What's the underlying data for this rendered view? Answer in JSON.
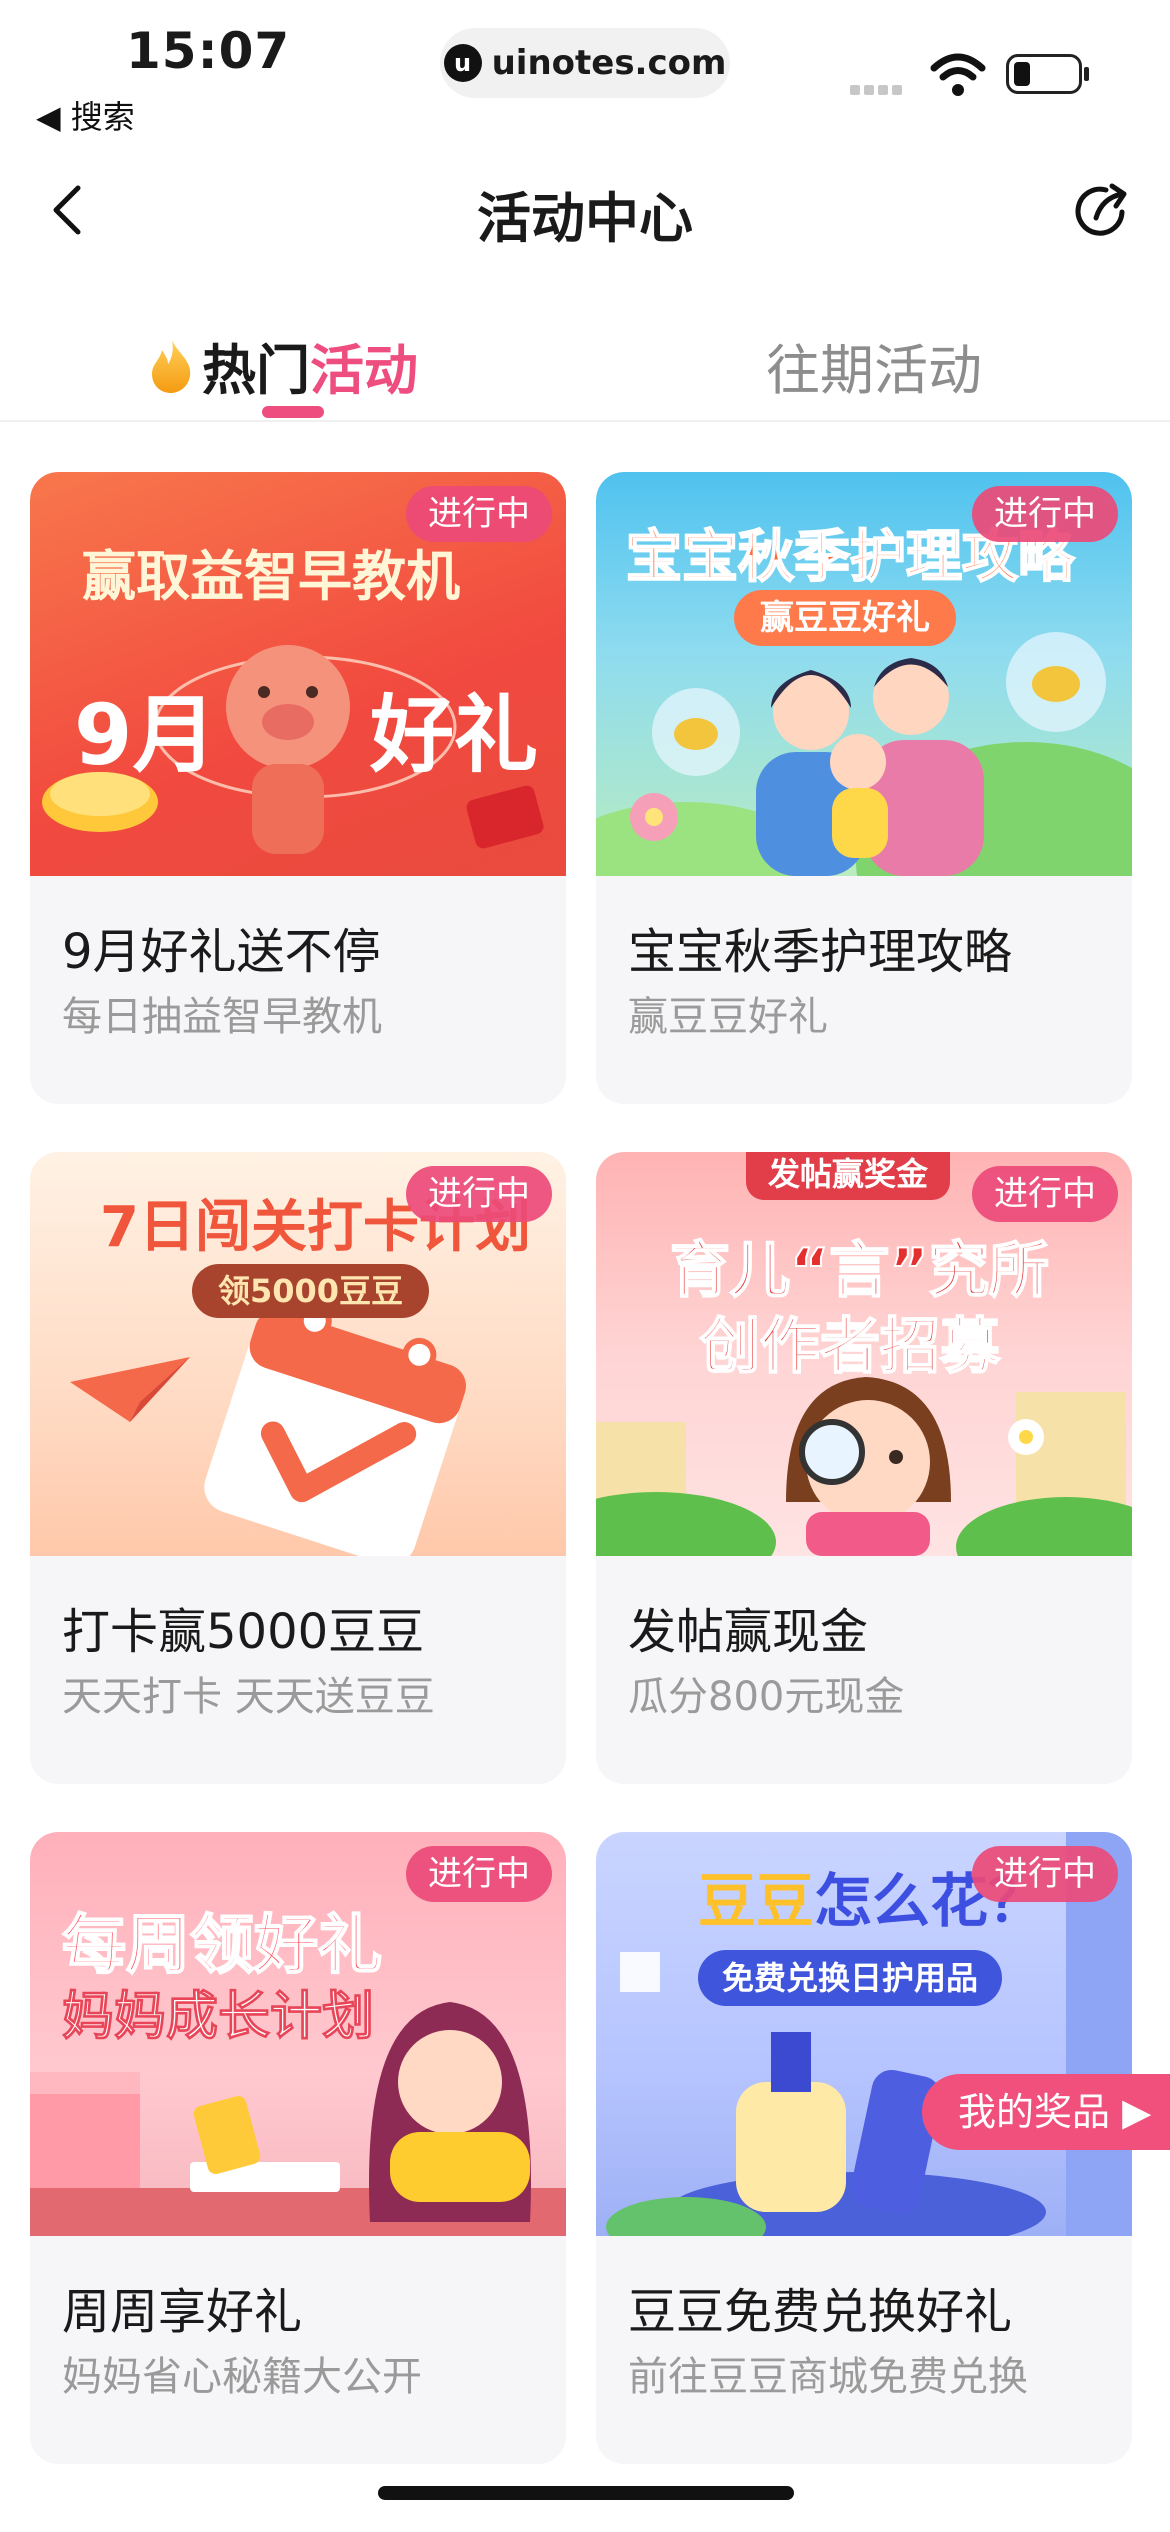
{
  "status_bar": {
    "time": "15:07",
    "back_app": "◀ 搜索",
    "url": "uinotes.com"
  },
  "nav": {
    "title": "活动中心"
  },
  "tabs": {
    "hot_prefix": "热门",
    "hot_accent": "活动",
    "past": "往期活动"
  },
  "badge_label": "进行中",
  "cards": [
    {
      "title": "9月好礼送不停",
      "subtitle": "每日抽益智早教机",
      "image": {
        "headline": "赢取益智早教机",
        "big_left": "9月",
        "big_right": "好礼"
      }
    },
    {
      "title": "宝宝秋季护理攻略",
      "subtitle": "赢豆豆好礼",
      "image": {
        "headline": "宝宝秋季护理攻略",
        "pill": "赢豆豆好礼"
      }
    },
    {
      "title": "打卡赢5000豆豆",
      "subtitle": "天天打卡 天天送豆豆",
      "image": {
        "headline": "7日闯关打卡计划",
        "pill": "领5000豆豆"
      }
    },
    {
      "title": "发帖赢现金",
      "subtitle": "瓜分800元现金",
      "image": {
        "top_tag": "发帖赢奖金",
        "line1": "育儿“言”究所",
        "line2": "创作者招募"
      }
    },
    {
      "title": "周周享好礼",
      "subtitle": "妈妈省心秘籍大公开",
      "image": {
        "line1": "每周领好礼",
        "line2": "妈妈成长计划"
      }
    },
    {
      "title": "豆豆免费兑换好礼",
      "subtitle": "前往豆豆商城免费兑换",
      "image": {
        "headline_a": "豆豆",
        "headline_b": "怎么花？",
        "pill": "免费兑换日护用品"
      }
    }
  ],
  "floating": {
    "my_prizes": "我的奖品 ▶"
  },
  "colors": {
    "accent": "#ee4d80",
    "badge": "#ec4a78",
    "card_bg": "#f6f6f8"
  }
}
